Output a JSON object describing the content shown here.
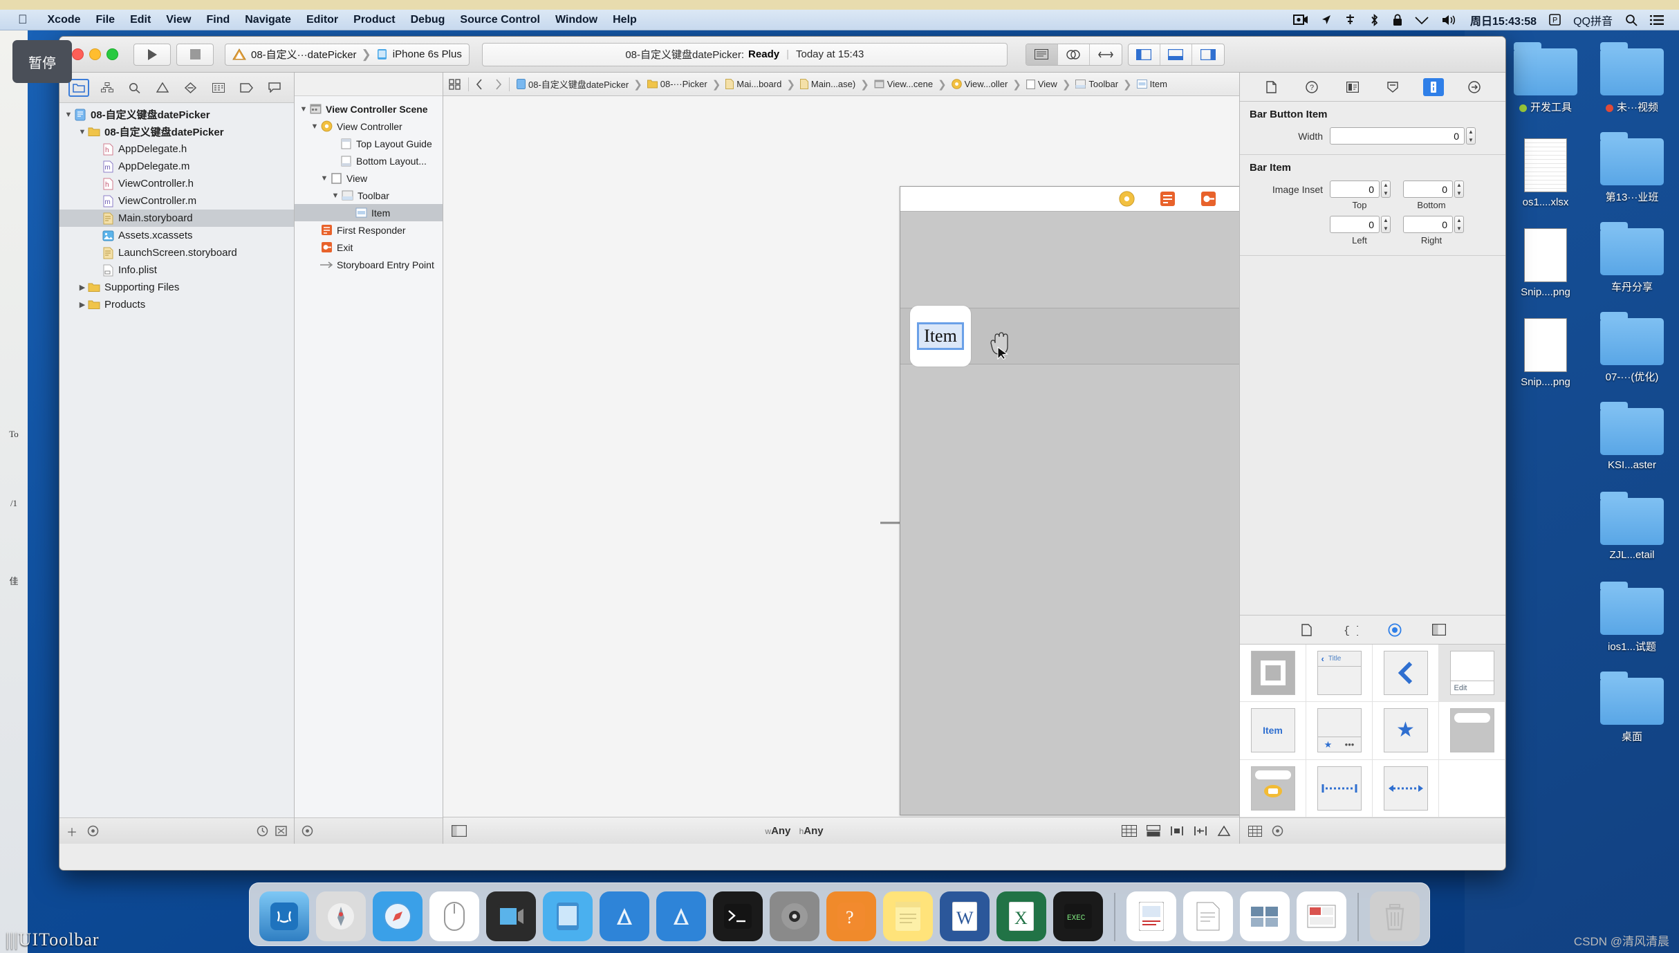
{
  "menubar": {
    "apple_icon": "apple-logo-icon",
    "items": [
      "Xcode",
      "File",
      "Edit",
      "View",
      "Find",
      "Navigate",
      "Editor",
      "Product",
      "Debug",
      "Source Control",
      "Window",
      "Help"
    ],
    "status_items": [
      {
        "name": "screen-record-icon",
        "glyph": "▣"
      },
      {
        "name": "location-icon",
        "glyph": "➤"
      },
      {
        "name": "airdrop-icon",
        "glyph": "✛"
      },
      {
        "name": "bluetooth-icon",
        "glyph": "✲"
      },
      {
        "name": "lock-icon",
        "glyph": "🔒"
      },
      {
        "name": "wifi-icon",
        "glyph": "▽"
      },
      {
        "name": "volume-icon",
        "glyph": "◀))"
      }
    ],
    "clock": "周日15:43:58",
    "input_badge": "P",
    "input_method": "QQ拼音",
    "search_icon": "search-icon",
    "notification_icon": "notification-center-icon"
  },
  "overlay": {
    "pause_label": "暂停"
  },
  "desktop": {
    "left_text": [
      "To",
      "/1",
      "佳"
    ],
    "bottom_left_text": "|||UIToolbar",
    "watermark": "CSDN @清风清晨",
    "icons": [
      {
        "label": "开发工具",
        "type": "folder",
        "dot": "#9ccc3a"
      },
      {
        "label": "未···视频",
        "type": "folder",
        "dot": "#e04a38"
      },
      {
        "label": "os1....xlsx",
        "type": "file",
        "badge": "XLSX"
      },
      {
        "label": "第13···业班",
        "type": "folder",
        "dot": ""
      },
      {
        "label": "Snip....png",
        "type": "file",
        "badge": ""
      },
      {
        "label": "车丹分享",
        "type": "folder",
        "dot": ""
      },
      {
        "label": "Snip....png",
        "type": "file",
        "badge": ""
      },
      {
        "label": "07-···(优化)",
        "type": "folder",
        "dot": ""
      },
      {
        "label": "KSI...aster",
        "type": "folder",
        "dot": ""
      },
      {
        "label": "ZJL...etail",
        "type": "folder",
        "dot": ""
      },
      {
        "label": "ios1...试题",
        "type": "folder",
        "dot": ""
      },
      {
        "label": "桌面",
        "type": "folder",
        "dot": ""
      }
    ]
  },
  "toolbar": {
    "run_icon": "run-play-icon",
    "stop_icon": "stop-square-icon",
    "scheme_project": "08-自定义···datePicker",
    "scheme_sep": "❯",
    "scheme_device": "iPhone 6s Plus",
    "status_project": "08-自定义键盘datePicker:",
    "status_state": "Ready",
    "status_sep": "|",
    "status_time": "Today at 15:43",
    "editor_segments": [
      "standard-editor-icon",
      "assistant-editor-icon",
      "version-editor-icon"
    ],
    "view_segments": [
      "toggle-navigator-icon",
      "toggle-debug-area-icon",
      "toggle-utilities-icon"
    ]
  },
  "navigator": {
    "tabs": [
      "project-navigator-icon",
      "symbol-navigator-icon",
      "find-navigator-icon",
      "issue-navigator-icon",
      "test-navigator-icon",
      "debug-navigator-icon",
      "breakpoint-navigator-icon",
      "report-navigator-icon"
    ],
    "items": [
      {
        "label": "08-自定义键盘datePicker",
        "depth": 0,
        "twisty": "▼",
        "icon": "xcode-project-icon",
        "selected": false
      },
      {
        "label": "08-自定义键盘datePicker",
        "depth": 1,
        "twisty": "▼",
        "icon": "folder-icon",
        "selected": false
      },
      {
        "label": "AppDelegate.h",
        "depth": 2,
        "twisty": "",
        "icon": "h-file-icon",
        "selected": false
      },
      {
        "label": "AppDelegate.m",
        "depth": 2,
        "twisty": "",
        "icon": "m-file-icon",
        "selected": false
      },
      {
        "label": "ViewController.h",
        "depth": 2,
        "twisty": "",
        "icon": "h-file-icon",
        "selected": false
      },
      {
        "label": "ViewController.m",
        "depth": 2,
        "twisty": "",
        "icon": "m-file-icon",
        "selected": false
      },
      {
        "label": "Main.storyboard",
        "depth": 2,
        "twisty": "",
        "icon": "storyboard-icon",
        "selected": true
      },
      {
        "label": "Assets.xcassets",
        "depth": 2,
        "twisty": "",
        "icon": "assets-icon",
        "selected": false
      },
      {
        "label": "LaunchScreen.storyboard",
        "depth": 2,
        "twisty": "",
        "icon": "storyboard-icon",
        "selected": false
      },
      {
        "label": "Info.plist",
        "depth": 2,
        "twisty": "",
        "icon": "plist-icon",
        "selected": false
      },
      {
        "label": "Supporting Files",
        "depth": 1,
        "twisty": "▶",
        "icon": "folder-icon",
        "selected": false
      },
      {
        "label": "Products",
        "depth": 1,
        "twisty": "▶",
        "icon": "folder-icon",
        "selected": false
      }
    ],
    "footer": {
      "add": "＋",
      "filter": "filter-icon",
      "recent": "recent-icon",
      "source": "source-control-icon"
    }
  },
  "outline": {
    "items": [
      {
        "label": "View Controller Scene",
        "depth": 0,
        "twisty": "▼",
        "icon": "scene-icon",
        "bold": true,
        "selected": false
      },
      {
        "label": "View Controller",
        "depth": 1,
        "twisty": "▼",
        "icon": "view-controller-icon",
        "bold": false,
        "selected": false
      },
      {
        "label": "Top Layout Guide",
        "depth": 2,
        "twisty": "",
        "icon": "top-layout-guide-icon",
        "bold": false,
        "selected": false
      },
      {
        "label": "Bottom Layout...",
        "depth": 2,
        "twisty": "",
        "icon": "bottom-layout-guide-icon",
        "bold": false,
        "selected": false
      },
      {
        "label": "View",
        "depth": 2,
        "twisty": "▼",
        "icon": "view-icon",
        "bold": false,
        "selected": false
      },
      {
        "label": "Toolbar",
        "depth": 3,
        "twisty": "▼",
        "icon": "toolbar-icon",
        "bold": false,
        "selected": false
      },
      {
        "label": "Item",
        "depth": 4,
        "twisty": "",
        "icon": "bar-button-item-icon",
        "bold": false,
        "selected": true
      },
      {
        "label": "First Responder",
        "depth": 1,
        "twisty": "",
        "icon": "first-responder-icon",
        "bold": false,
        "selected": false
      },
      {
        "label": "Exit",
        "depth": 1,
        "twisty": "",
        "icon": "exit-icon",
        "bold": false,
        "selected": false
      },
      {
        "label": "Storyboard Entry Point",
        "depth": 1,
        "twisty": "",
        "icon": "entry-point-arrow-icon",
        "bold": false,
        "selected": false
      }
    ]
  },
  "jumpbar": {
    "related_icon": "related-items-icon",
    "back_icon": "◀",
    "forward_icon": "▶",
    "crumbs": [
      {
        "label": "08-自定义键盘datePicker",
        "icon": "xcode-project-icon"
      },
      {
        "label": "08-···Picker",
        "icon": "folder-icon"
      },
      {
        "label": "Mai...board",
        "icon": "storyboard-icon"
      },
      {
        "label": "Main...ase)",
        "icon": "storyboard-icon"
      },
      {
        "label": "View...cene",
        "icon": "scene-icon"
      },
      {
        "label": "View...oller",
        "icon": "view-controller-icon"
      },
      {
        "label": "View",
        "icon": "view-icon"
      },
      {
        "label": "Toolbar",
        "icon": "toolbar-icon"
      },
      {
        "label": "Item",
        "icon": "bar-button-item-icon"
      }
    ]
  },
  "canvas": {
    "bar_item_label": "Item",
    "entry_arrow": "entry-point-arrow",
    "cursor": "open-hand-cursor",
    "footer": {
      "toggle_outline_icon": "toggle-document-outline-icon",
      "size_class_w_prefix": "w",
      "size_class_w": "Any",
      "size_class_h_prefix": "h",
      "size_class_h": "Any",
      "tools": [
        "auto-layout-update-icon",
        "embed-in-icon",
        "align-icon",
        "pin-icon",
        "resolve-issues-icon"
      ]
    }
  },
  "inspector": {
    "tabs": [
      "file-inspector-icon",
      "quick-help-icon",
      "identity-inspector-icon",
      "attributes-inspector-icon",
      "size-inspector-icon",
      "connections-inspector-icon"
    ],
    "active_tab_index": 4,
    "sections": [
      {
        "title": "Bar Button Item",
        "fields": [
          {
            "label": "Width",
            "value": "0",
            "sub": ""
          }
        ]
      },
      {
        "title": "Bar Item",
        "inset_label": "Image Inset",
        "insets": [
          {
            "value": "0",
            "sub": "Top"
          },
          {
            "value": "0",
            "sub": "Bottom"
          },
          {
            "value": "0",
            "sub": "Left"
          },
          {
            "value": "0",
            "sub": "Right"
          }
        ]
      }
    ],
    "library": {
      "tabs": [
        "file-template-library-icon",
        "code-snippet-library-icon",
        "object-library-icon",
        "media-library-icon"
      ],
      "active_tab_index": 2,
      "items": [
        {
          "name": "toolbar-object",
          "label": ""
        },
        {
          "name": "navigation-bar-object",
          "label": "Title"
        },
        {
          "name": "navigation-item-object",
          "label": ""
        },
        {
          "name": "toolbar-item-object",
          "label": "Edit"
        },
        {
          "name": "bar-button-item-object",
          "label": "Item"
        },
        {
          "name": "tab-bar-object",
          "label": ""
        },
        {
          "name": "tab-bar-item-object",
          "label": ""
        },
        {
          "name": "search-bar-scope-object",
          "label": ""
        },
        {
          "name": "search-bar-object",
          "label": ""
        },
        {
          "name": "fixed-space-bar-item-object",
          "label": ""
        },
        {
          "name": "flexible-space-bar-item-object",
          "label": ""
        }
      ],
      "footer": {
        "layout_icon": "library-layout-icon",
        "filter_icon": "library-filter-icon"
      }
    }
  },
  "dock": {
    "items": [
      {
        "name": "finder",
        "glyph": "🙂",
        "color": "#2f9ce8"
      },
      {
        "name": "launchpad",
        "glyph": "🚀",
        "color": "#c8c8c8"
      },
      {
        "name": "safari",
        "glyph": "🧭",
        "color": "#3aa0e8"
      },
      {
        "name": "mouse-app",
        "glyph": "🖱",
        "color": "#ffffff"
      },
      {
        "name": "quicktime-player",
        "glyph": "🎬",
        "color": "#2b2b2b"
      },
      {
        "name": "simulator",
        "glyph": "📱",
        "color": "#4ab0ef"
      },
      {
        "name": "xcode",
        "glyph": "🔨",
        "color": "#2e84d8"
      },
      {
        "name": "xcode-beta",
        "glyph": "🔨",
        "color": "#2e84d8"
      },
      {
        "name": "terminal",
        "glyph": "＞_",
        "color": "#1a1a1a"
      },
      {
        "name": "system-preferences",
        "glyph": "⚙",
        "color": "#8a8a8a"
      },
      {
        "name": "sketch",
        "glyph": "？",
        "color": "#f08a2b"
      },
      {
        "name": "notes",
        "glyph": "📝",
        "color": "#ffe37a"
      },
      {
        "name": "word",
        "glyph": "W",
        "color": "#2b579a"
      },
      {
        "name": "excel",
        "glyph": "X",
        "color": "#217346"
      },
      {
        "name": "executable",
        "glyph": "EXEC",
        "color": "#1a1a1a"
      },
      {
        "name": "keynote-doc",
        "glyph": "▤",
        "color": "#ffffff"
      },
      {
        "name": "text-doc",
        "glyph": "📄",
        "color": "#ffffff"
      },
      {
        "name": "screens-doc",
        "glyph": "▭",
        "color": "#ffffff"
      },
      {
        "name": "presentation-doc",
        "glyph": "▦",
        "color": "#ffffff"
      },
      {
        "name": "trash",
        "glyph": "🗑",
        "color": "#cfcfcf"
      }
    ]
  }
}
